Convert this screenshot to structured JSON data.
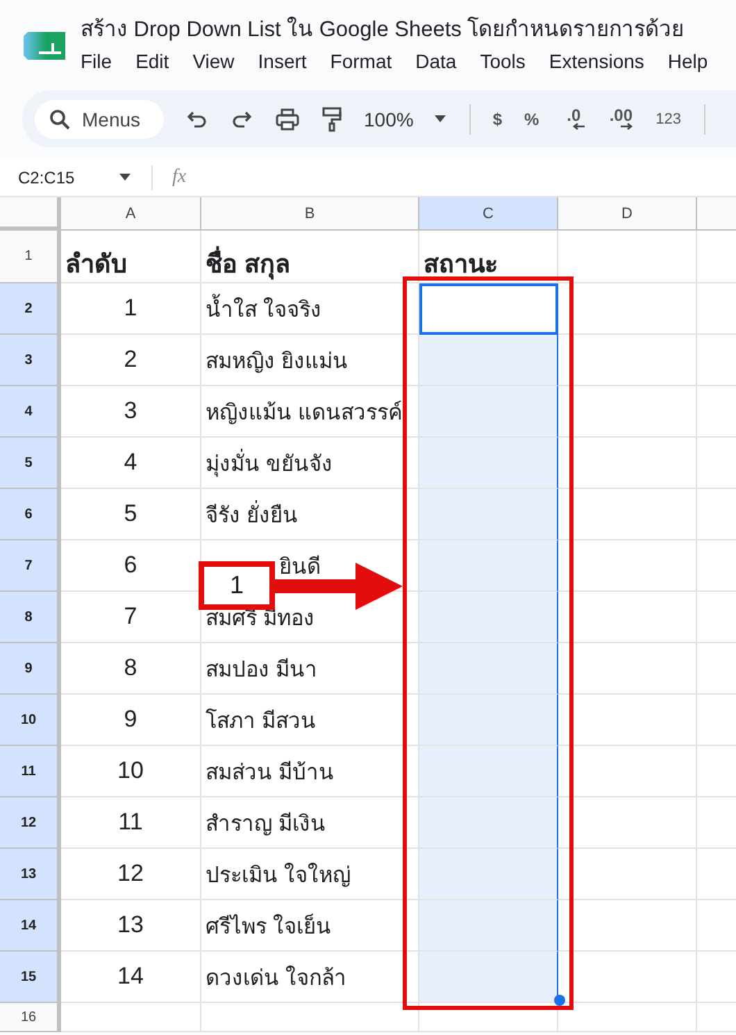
{
  "app": {
    "title": "สร้าง Drop Down List ใน Google Sheets โดยกำหนดรายการด้วย",
    "menus": [
      "File",
      "Edit",
      "View",
      "Insert",
      "Format",
      "Data",
      "Tools",
      "Extensions",
      "Help"
    ]
  },
  "toolbar": {
    "search": {
      "placeholder": "Menus"
    },
    "zoom": "100%",
    "currency": "$",
    "percent": "%",
    "decrease_decimal": ".0",
    "increase_decimal": ".00",
    "number_format": "123"
  },
  "formula_bar": {
    "name_box": "C2:C15",
    "function_label": "fx"
  },
  "sheet": {
    "columns": [
      {
        "label": "A",
        "selected": false
      },
      {
        "label": "B",
        "selected": false
      },
      {
        "label": "C",
        "selected": true
      },
      {
        "label": "D",
        "selected": false
      }
    ],
    "rows": [
      {
        "number": "1",
        "kind": "header",
        "selected": false,
        "order": "ลำดับ",
        "name": "ชื่อ สกุล",
        "status": "สถานะ"
      },
      {
        "number": "2",
        "kind": "data",
        "selected": true,
        "active": true,
        "order": "1",
        "name": "น้ำใส ใจจริง"
      },
      {
        "number": "3",
        "kind": "data",
        "selected": true,
        "active": false,
        "order": "2",
        "name": "สมหญิง ยิงแม่น"
      },
      {
        "number": "4",
        "kind": "data",
        "selected": true,
        "active": false,
        "order": "3",
        "name": "หญิงแม้น แดนสวรรค์"
      },
      {
        "number": "5",
        "kind": "data",
        "selected": true,
        "active": false,
        "order": "4",
        "name": "มุ่งมั่น ขยันจัง"
      },
      {
        "number": "6",
        "kind": "data",
        "selected": true,
        "active": false,
        "order": "5",
        "name": "จีรัง ยั่งยืน"
      },
      {
        "number": "7",
        "kind": "data",
        "selected": true,
        "active": false,
        "order": "6",
        "name": "ยินดี",
        "covered": true
      },
      {
        "number": "8",
        "kind": "data",
        "selected": true,
        "active": false,
        "order": "7",
        "name": "สมศรี มีทอง"
      },
      {
        "number": "9",
        "kind": "data",
        "selected": true,
        "active": false,
        "order": "8",
        "name": "สมปอง มีนา"
      },
      {
        "number": "10",
        "kind": "data",
        "selected": true,
        "active": false,
        "order": "9",
        "name": "โสภา มีสวน"
      },
      {
        "number": "11",
        "kind": "data",
        "selected": true,
        "active": false,
        "order": "10",
        "name": "สมส่วน มีบ้าน"
      },
      {
        "number": "12",
        "kind": "data",
        "selected": true,
        "active": false,
        "order": "11",
        "name": "สำราญ มีเงิน"
      },
      {
        "number": "13",
        "kind": "data",
        "selected": true,
        "active": false,
        "order": "12",
        "name": "ประเมิน ใจใหญ่"
      },
      {
        "number": "14",
        "kind": "data",
        "selected": true,
        "active": false,
        "order": "13",
        "name": "ศรีไพร ใจเย็น"
      },
      {
        "number": "15",
        "kind": "data",
        "selected": true,
        "active": false,
        "order": "14",
        "name": "ดวงเด่น ใจกล้า"
      },
      {
        "number": "16",
        "kind": "empty",
        "selected": false
      }
    ]
  },
  "callout": {
    "label": "1"
  }
}
